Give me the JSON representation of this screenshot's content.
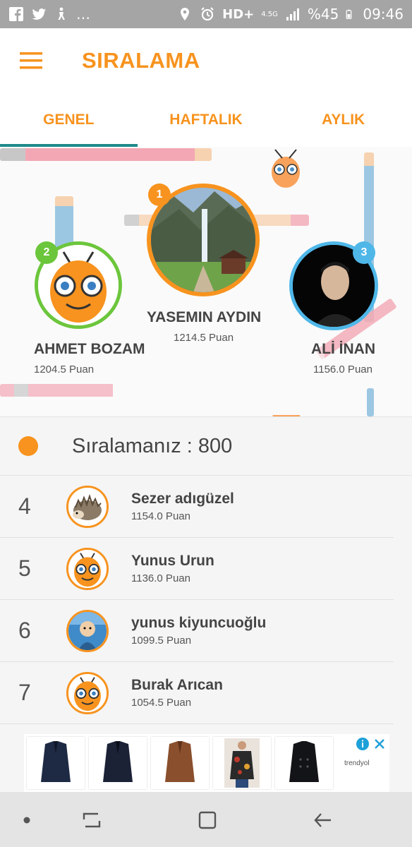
{
  "status_bar": {
    "signal_text": "HD+",
    "network": "4.5G",
    "battery": "%45",
    "time": "09:46"
  },
  "toolbar": {
    "title": "SIRALAMA",
    "menu_icon": "hamburger-menu-icon"
  },
  "tabs": [
    {
      "label": "GENEL",
      "active": true
    },
    {
      "label": "HAFTALIK",
      "active": false
    },
    {
      "label": "AYLIK",
      "active": false
    }
  ],
  "podium": {
    "first": {
      "rank": "1",
      "name": "YASEMIN AYDIN",
      "points": "1214.5 Puan",
      "ring_color": "#f7931e"
    },
    "second": {
      "rank": "2",
      "name": "AHMET BOZAM",
      "points": "1204.5 Puan",
      "ring_color": "#6cc63c"
    },
    "third": {
      "rank": "3",
      "name": "ALİ İNAN",
      "points": "1156.0 Puan",
      "ring_color": "#4fb7e8"
    }
  },
  "my_rank": {
    "label": "Sıralamanız : 800"
  },
  "list": [
    {
      "rank": "4",
      "name": "Sezer adıgüzel",
      "points": "1154.0 Puan",
      "avatar": "hedgehog"
    },
    {
      "rank": "5",
      "name": "Yunus Urun",
      "points": "1136.0 Puan",
      "avatar": "mascot"
    },
    {
      "rank": "6",
      "name": "yunus kiyuncuoğlu",
      "points": "1099.5 Puan",
      "avatar": "baby"
    },
    {
      "rank": "7",
      "name": "Burak Arıcan",
      "points": "1054.5 Puan",
      "avatar": "mascot"
    }
  ],
  "ad": {
    "brand": "trendyol",
    "items": [
      "coat-navy",
      "coat-dark",
      "coat-brown",
      "coat-floral",
      "coat-black"
    ]
  },
  "colors": {
    "accent": "#f7931e",
    "tab_indicator": "#1e8a8a",
    "second": "#6cc63c",
    "third": "#4fb7e8"
  }
}
